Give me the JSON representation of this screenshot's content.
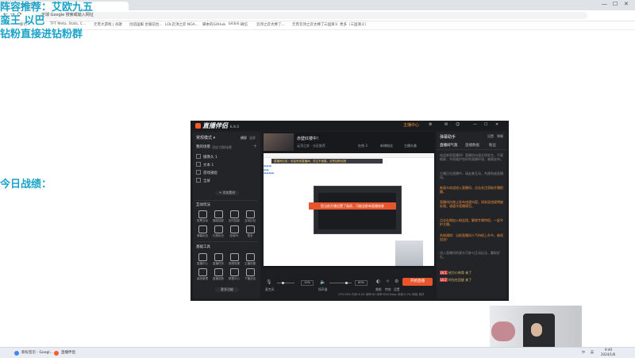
{
  "browser": {
    "tab_title": "新标签页",
    "url_text": "全球·Google 搜索或输入网址",
    "bookmarks": [
      "索引",
      "TFT Meta, Stats, C...",
      "元宵大游戏 | 谷歌",
      "创造国服 合服前台...",
      "LOL云顶之弈 NGA...",
      "脚本的GitHub",
      "bilibili…",
      "微信",
      "云顶之弈太棒了...",
      "元宵云顶之弈太棒了..",
      "三国演义",
      "更多（三国演义）"
    ]
  },
  "overlay": {
    "line1": "阵容推荐：艾欧九五",
    "line2": "蛮王 以巴",
    "line3": "钻粉直接进钻粉群",
    "line4": "今日战绩："
  },
  "app": {
    "logo": "直播伴侣",
    "version": "6.9.5",
    "top_right": [
      "主播中心",
      "帮助",
      "设置"
    ],
    "mode_label": "常规模式",
    "mode_options": [
      "横屏",
      "竖屏"
    ],
    "scene_header": "我的场景",
    "scene_sub": [
      "添加",
      "切换场景"
    ],
    "scenes": [
      "摄像头 1",
      "文本 1",
      "游戏捕捉",
      "全屏"
    ],
    "add_material": "+ 添加素材",
    "interact_header": "互动玩法",
    "interact_tools": [
      "投票互动",
      "福袋抽奖",
      "定时抽奖",
      "互动红包",
      "弹幕玩法",
      "礼物玩法",
      "连线PK",
      "更多"
    ],
    "basic_header": "基础工具",
    "basic_tools": [
      "直播中心",
      "直播任务",
      "音频效果",
      "主播设置",
      "装扮管理",
      "直播回放",
      "数据中心",
      "下播总结"
    ],
    "more_tools": "更多功能",
    "streamer_title": "赤壁红楼中！",
    "streamer_sub": "云顶之弈 · 分区推荐",
    "streamer_stats": [
      "在线 3",
      "新增粉丝",
      "主播头像"
    ],
    "notice_text": "直播间公告：欢迎来到直播间，关注不迷路，点赞加粉丝团",
    "toast_text": "您当前开播设置了画质，可能会影响直播效果",
    "controls": {
      "mic_label": "麦克风",
      "mic_pct": "10%",
      "speaker_label": "扬声器",
      "speaker_pct": "80%",
      "btn_beauty": "美颜",
      "btn_effects": "特效",
      "btn_settings": "设置",
      "go_live": "开始直播"
    },
    "status_bar": "CPU:26%   内存:6.0G   帧率:60   码率:6000kbps   丢帧:0.0%   网络:良好"
  },
  "right_panel": {
    "title": "弹幕助手",
    "actions": [
      "设置",
      "弹幕"
    ],
    "tabs": [
      "直播间气氛",
      "直播数据",
      "粉丝"
    ],
    "messages": [
      {
        "style": "gray",
        "text": "欢迎来到直播间！直播间内请文明发言，不要刷屏，共同维护良好的直播环境，感谢支持。"
      },
      {
        "style": "gray",
        "text": "主播正在直播中，请友善互动，共建和谐直播间。"
      },
      {
        "style": "org",
        "text": "新观众欢迎进入直播间，点击关注获取开播提醒。"
      },
      {
        "style": "org",
        "text": "直播间内禁止发布违规内容，如发现违规将被处理，请遵守直播规范。"
      },
      {
        "style": "org",
        "text": "点击右侧加入粉丝团，解锁专属特权，一起守护主播。"
      },
      {
        "style": "org",
        "text": "系统通知：当前直播间人气持续上升中，继续加油！"
      },
      {
        "style": "gray",
        "text": "进入直播间的观众可参与互动玩法，赢取好礼。"
      },
      {
        "badge": "LV.1",
        "style": "yel",
        "text": "给力小帅哥 来了"
      },
      {
        "badge": "LV.2",
        "style": "yel",
        "text": "时光在回放 来了"
      }
    ]
  },
  "taskbar": {
    "items": [
      "新标签页 - Googl...",
      "直播伴侣"
    ],
    "time": "9:40",
    "date": "2024/1/8",
    "tray": [
      "中",
      "英"
    ]
  }
}
